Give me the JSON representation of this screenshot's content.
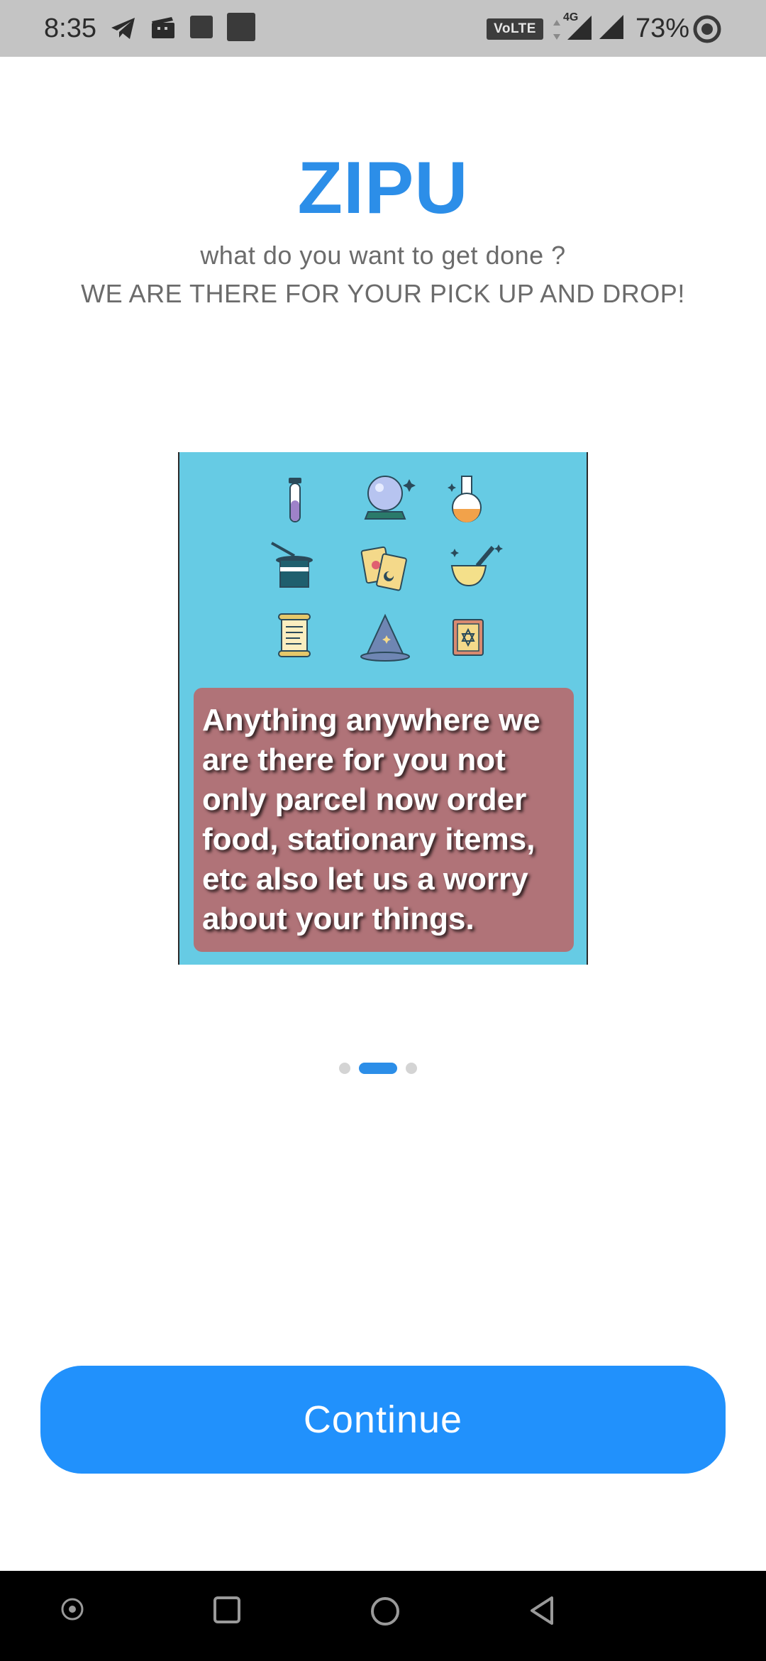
{
  "status_bar": {
    "time": "8:35",
    "network_badge": "VoLTE",
    "network_type": "4G",
    "battery_percent": "73%",
    "icons": [
      "telegram-icon",
      "clapperboard-icon",
      "notification-square-icon",
      "notification-square-icon",
      "signal-icon",
      "signal-icon",
      "battery-ring-icon"
    ]
  },
  "header": {
    "brand": "ZIPU",
    "tagline_line1": "what do you want to get done ?",
    "tagline_line2": "WE ARE THERE FOR YOUR PICK UP AND DROP!"
  },
  "carousel": {
    "current_index": 2,
    "total_slides": 3,
    "slide": {
      "caption": "Anything anywhere we are there for you not only parcel now order food, stationary items, etc also let us a worry about your things.",
      "background_color": "#66cbe4",
      "caption_box_color": "#b07378",
      "icons": [
        "test-tube-icon",
        "crystal-ball-icon",
        "flask-icon",
        "magic-hat-icon",
        "tarot-cards-icon",
        "mortar-pestle-icon",
        "scroll-icon",
        "wizard-hat-icon",
        "spell-book-icon"
      ]
    }
  },
  "actions": {
    "continue_label": "Continue"
  },
  "nav_bar": {
    "buttons": [
      "assistant-icon",
      "recents-icon",
      "home-icon",
      "back-icon"
    ]
  },
  "colors": {
    "accent": "#2c8ee8",
    "button": "#2191fc",
    "text_secondary": "#6b6b6b",
    "status_bar_bg": "#c4c4c4"
  }
}
